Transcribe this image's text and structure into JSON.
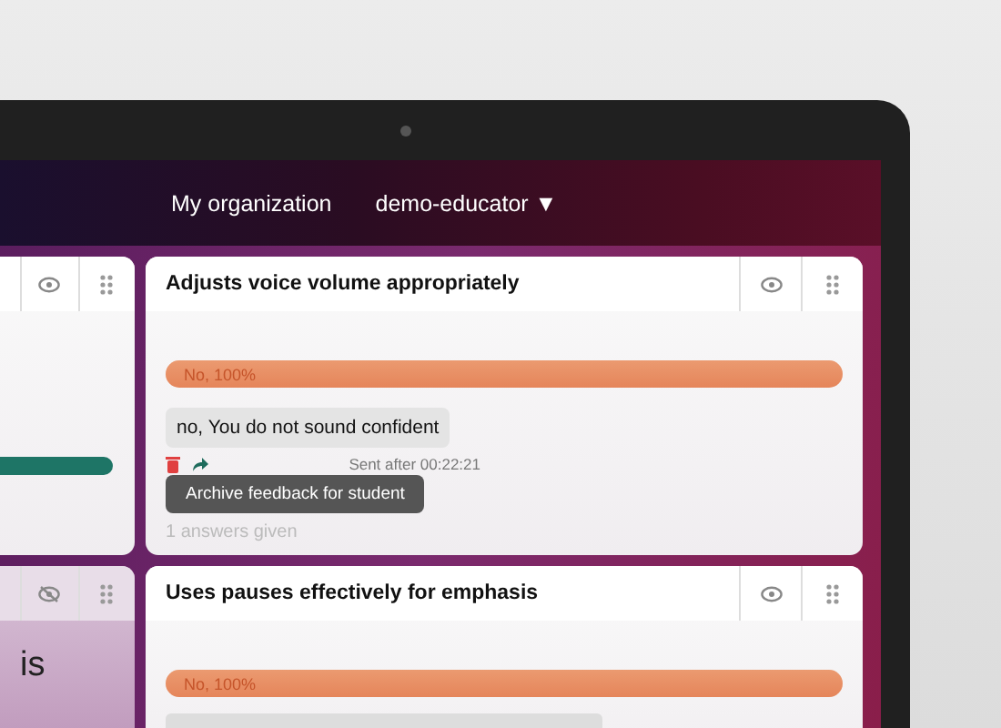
{
  "navbar": {
    "links": [
      {
        "label": "My organization"
      },
      {
        "label": "demo-educator",
        "caret": "▼"
      }
    ]
  },
  "left_cards": [
    {
      "visible": true,
      "bar": true
    },
    {
      "visible": false,
      "text": "is"
    }
  ],
  "cards": [
    {
      "title": "Adjusts voice volume appropriately",
      "visible": true,
      "result": {
        "label": "No, 100%",
        "level": 1
      },
      "feedback": {
        "text": "no, You do not sound confident",
        "sent": "Sent after 00:22:21",
        "tooltip": "Archive feedback for student"
      },
      "footer": "1 answers given"
    },
    {
      "title": "Uses pauses effectively for emphasis",
      "visible": true,
      "result": {
        "label": "No, 100%",
        "level": 1
      }
    }
  ]
}
